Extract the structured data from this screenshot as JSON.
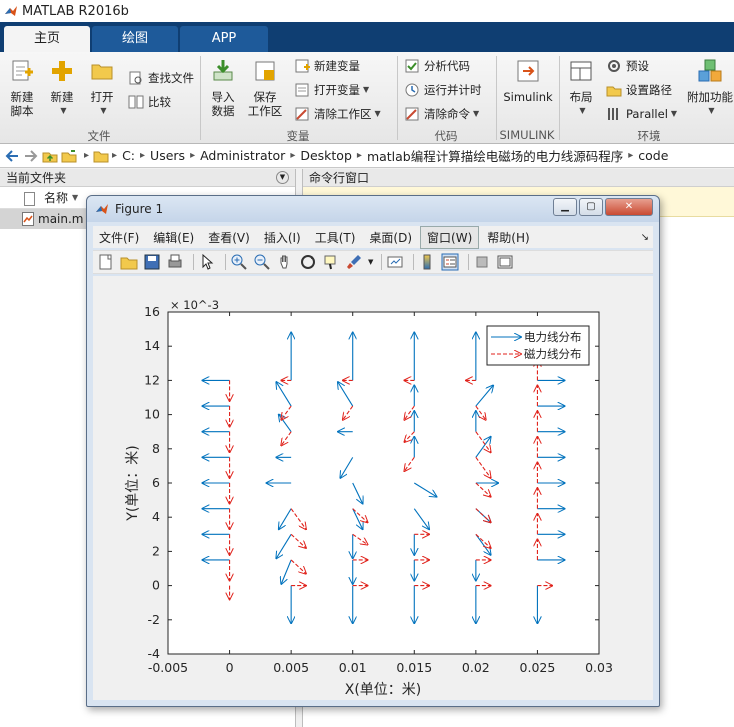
{
  "app": {
    "title": "MATLAB R2016b"
  },
  "tabs": [
    "主页",
    "绘图",
    "APP"
  ],
  "ribbon": {
    "file": {
      "new_script": "新建\n脚本",
      "new": "新建",
      "open": "打开",
      "find_files": "查找文件",
      "compare": "比较",
      "label": "文件"
    },
    "variable": {
      "import": "导入\n数据",
      "save_ws": "保存\n工作区",
      "new_var": "新建变量",
      "open_var": "打开变量",
      "clear_ws": "清除工作区",
      "label": "变量"
    },
    "code": {
      "analyze": "分析代码",
      "run_time": "运行并计时",
      "clear_cmd": "清除命令",
      "label": "代码"
    },
    "simulink": {
      "button": "Simulink",
      "label": "SIMULINK"
    },
    "env": {
      "layout": "布局",
      "prefs": "预设",
      "set_path": "设置路径",
      "parallel": "Parallel",
      "label": "环境"
    },
    "addons": {
      "label": "附加功能"
    }
  },
  "address": [
    "C:",
    "Users",
    "Administrator",
    "Desktop",
    "matlab编程计算描绘电磁场的电力线源码程序",
    "code"
  ],
  "left_panel": {
    "title": "当前文件夹",
    "col_name": "名称",
    "file": "main.m"
  },
  "right_panel": {
    "title": "命令行窗口"
  },
  "figure": {
    "title": "Figure 1",
    "menus": [
      "文件(F)",
      "编辑(E)",
      "查看(V)",
      "插入(I)",
      "工具(T)",
      "桌面(D)",
      "窗口(W)",
      "帮助(H)"
    ],
    "selected_menu_index": 6
  },
  "chart_data": {
    "type": "quiver",
    "xlabel": "X(单位：米)",
    "ylabel": "Y(单位：米)",
    "y_exponent": "× 10^-3",
    "xlim": [
      -0.005,
      0.03
    ],
    "ylim": [
      -0.004,
      0.016
    ],
    "xticks": [
      "-0.005",
      "0",
      "0.005",
      "0.01",
      "0.015",
      "0.02",
      "0.025",
      "0.03"
    ],
    "yticks": [
      "-4",
      "-2",
      "0",
      "2",
      "4",
      "6",
      "8",
      "10",
      "12",
      "14",
      "16"
    ],
    "ytick_values": [
      -0.004,
      -0.002,
      0,
      0.002,
      0.004,
      0.006,
      0.008,
      0.01,
      0.012,
      0.014,
      0.016
    ],
    "xtick_values": [
      -0.005,
      0,
      0.005,
      0.01,
      0.015,
      0.02,
      0.025,
      0.03
    ],
    "legend_position": "top-right",
    "grid": false,
    "series": [
      {
        "name": "电力线分布",
        "color": "#0072bd",
        "style": "solid",
        "vectors": [
          [
            0,
            0.012,
            -0.0022,
            0
          ],
          [
            0,
            0.0105,
            -0.0022,
            0
          ],
          [
            0,
            0.009,
            -0.0022,
            0
          ],
          [
            0,
            0.0075,
            -0.0022,
            0
          ],
          [
            0,
            0.006,
            -0.0022,
            0
          ],
          [
            0,
            0.0045,
            -0.0022,
            0
          ],
          [
            0,
            0.003,
            -0.0022,
            0
          ],
          [
            0,
            0.0015,
            -0.0022,
            0
          ],
          [
            0.005,
            0.012,
            0,
            0.0028
          ],
          [
            0.005,
            0.0105,
            -0.0012,
            0.0014
          ],
          [
            0.005,
            0.009,
            -0.001,
            0.001
          ],
          [
            0.005,
            0.0075,
            -0.0012,
            0
          ],
          [
            0.005,
            0.006,
            -0.002,
            0
          ],
          [
            0.005,
            0.0045,
            -0.001,
            -0.0012
          ],
          [
            0.005,
            0.003,
            -0.0012,
            -0.0014
          ],
          [
            0.005,
            0.0015,
            -0.0008,
            -0.0014
          ],
          [
            0.005,
            0,
            0,
            -0.0022
          ],
          [
            0.01,
            0.012,
            0,
            0.0028
          ],
          [
            0.01,
            0.0105,
            -0.0012,
            0.0014
          ],
          [
            0.01,
            0.009,
            -0.0012,
            0
          ],
          [
            0.01,
            0.0075,
            -0.001,
            -0.0012
          ],
          [
            0.01,
            0.006,
            0.0008,
            -0.0012
          ],
          [
            0.01,
            0.0045,
            0.0008,
            -0.0012
          ],
          [
            0.01,
            0.003,
            0,
            -0.0014
          ],
          [
            0.01,
            0.0015,
            0,
            -0.0014
          ],
          [
            0.01,
            0,
            0,
            -0.0022
          ],
          [
            0.015,
            0.012,
            0,
            0.0028
          ],
          [
            0.015,
            0.0105,
            0,
            0.0012
          ],
          [
            0.015,
            0.009,
            0,
            0.0012
          ],
          [
            0.015,
            0.0075,
            0,
            0.0012
          ],
          [
            0.015,
            0.006,
            0.0018,
            -0.0008
          ],
          [
            0.015,
            0.0045,
            0.0012,
            -0.0012
          ],
          [
            0.015,
            0.003,
            0,
            -0.0012
          ],
          [
            0.015,
            0.0015,
            0,
            -0.0012
          ],
          [
            0.015,
            0,
            0,
            -0.0022
          ],
          [
            0.02,
            0.012,
            0,
            0.0028
          ],
          [
            0.02,
            0.0105,
            0.0014,
            0.0012
          ],
          [
            0.02,
            0.009,
            0,
            0.0012
          ],
          [
            0.02,
            0.0075,
            0.0012,
            0.0012
          ],
          [
            0.02,
            0.006,
            0.0018,
            0
          ],
          [
            0.02,
            0.0045,
            0.0012,
            -0.0008
          ],
          [
            0.02,
            0.003,
            0.0012,
            -0.0012
          ],
          [
            0.02,
            0.0015,
            0,
            -0.0012
          ],
          [
            0.02,
            0,
            0,
            -0.0022
          ],
          [
            0.025,
            0.012,
            0.0022,
            0
          ],
          [
            0.025,
            0.0105,
            0.0022,
            0
          ],
          [
            0.025,
            0.009,
            0.0022,
            0
          ],
          [
            0.025,
            0.0075,
            0.0022,
            0
          ],
          [
            0.025,
            0.006,
            0.0022,
            0
          ],
          [
            0.025,
            0.0045,
            0.0022,
            0
          ],
          [
            0.025,
            0.003,
            0.0022,
            0
          ],
          [
            0.025,
            0.0015,
            0.0022,
            0
          ],
          [
            0.025,
            0,
            0,
            -0.0022
          ]
        ]
      },
      {
        "name": "磁力线分布",
        "color": "#e0221b",
        "style": "dashed",
        "vectors": [
          [
            0,
            0.012,
            0,
            -0.0012
          ],
          [
            0,
            0.0105,
            0,
            -0.0012
          ],
          [
            0,
            0.009,
            0,
            -0.0012
          ],
          [
            0,
            0.0075,
            0,
            -0.0012
          ],
          [
            0,
            0.006,
            0,
            -0.0012
          ],
          [
            0,
            0.0045,
            0,
            -0.0012
          ],
          [
            0,
            0.003,
            0,
            -0.0012
          ],
          [
            0,
            0.0015,
            0,
            -0.0012
          ],
          [
            0,
            0,
            0,
            -0.0008
          ],
          [
            0.005,
            0.012,
            -0.0008,
            0
          ],
          [
            0.005,
            0.0105,
            -0.0008,
            -0.0008
          ],
          [
            0.005,
            0.009,
            -0.0008,
            -0.0008
          ],
          [
            0.005,
            0.0045,
            0.0012,
            -0.0012
          ],
          [
            0.005,
            0.003,
            0.0012,
            -0.0008
          ],
          [
            0.005,
            0.0015,
            0.0012,
            -0.0008
          ],
          [
            0.005,
            0,
            0.0012,
            0
          ],
          [
            0.01,
            0.012,
            -0.0008,
            0
          ],
          [
            0.01,
            0.0105,
            -0.0008,
            -0.0008
          ],
          [
            0.01,
            0.0045,
            0.0012,
            -0.0008
          ],
          [
            0.01,
            0.003,
            0.0012,
            -0.0006
          ],
          [
            0.01,
            0.0015,
            0.0012,
            0
          ],
          [
            0.01,
            0,
            0.0012,
            0
          ],
          [
            0.015,
            0.012,
            -0.0008,
            0
          ],
          [
            0.015,
            0.0105,
            -0.0008,
            -0.0008
          ],
          [
            0.015,
            0.009,
            -0.0008,
            -0.0006
          ],
          [
            0.015,
            0.0075,
            -0.0008,
            -0.0008
          ],
          [
            0.015,
            0.003,
            0.0012,
            0
          ],
          [
            0.015,
            0.0015,
            0.0012,
            0
          ],
          [
            0.015,
            0,
            0.0012,
            0
          ],
          [
            0.02,
            0.012,
            -0.0008,
            0
          ],
          [
            0.02,
            0.0105,
            0.0008,
            -0.0008
          ],
          [
            0.02,
            0.009,
            0.0012,
            -0.0012
          ],
          [
            0.02,
            0.0075,
            0.0012,
            -0.0012
          ],
          [
            0.02,
            0.006,
            0.0012,
            -0.0008
          ],
          [
            0.02,
            0.0045,
            0.0012,
            -0.0008
          ],
          [
            0.02,
            0.003,
            0.0012,
            -0.0008
          ],
          [
            0.02,
            0.0015,
            0.0012,
            0
          ],
          [
            0.02,
            0,
            0.0012,
            0
          ],
          [
            0.025,
            0.012,
            0,
            0.0012
          ],
          [
            0.025,
            0.0105,
            0,
            0.0012
          ],
          [
            0.025,
            0.009,
            0,
            0.0012
          ],
          [
            0.025,
            0.0075,
            0,
            0.0012
          ],
          [
            0.025,
            0.006,
            0,
            0.0012
          ],
          [
            0.025,
            0.0045,
            0,
            0.0012
          ],
          [
            0.025,
            0.003,
            0,
            0.0012
          ],
          [
            0.025,
            0.0015,
            0,
            0.0012
          ],
          [
            0.025,
            0,
            0.0012,
            0
          ]
        ]
      }
    ]
  }
}
